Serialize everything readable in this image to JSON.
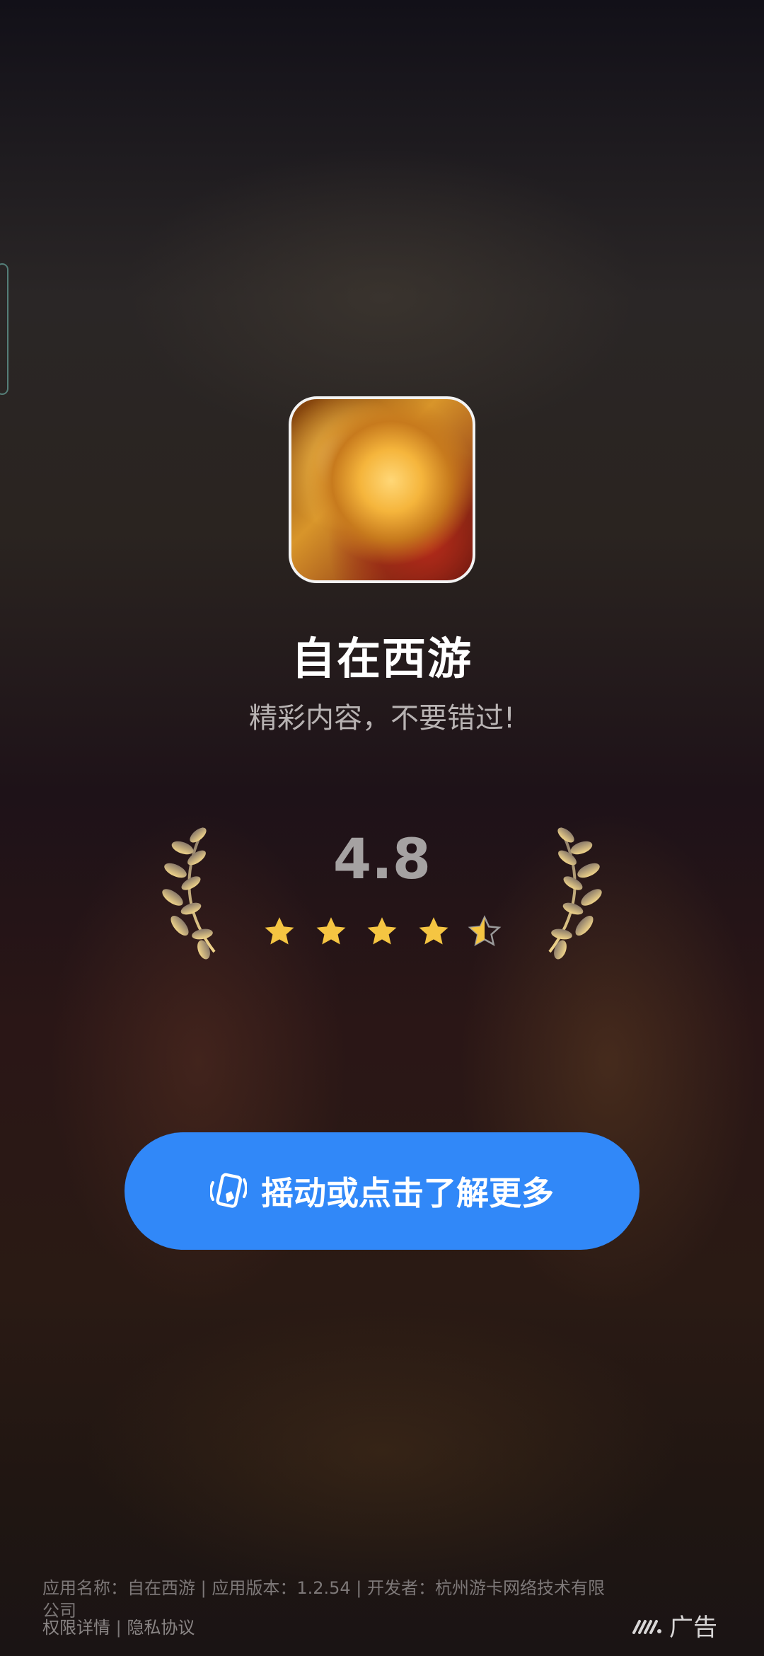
{
  "app": {
    "name": "自在西游",
    "tagline": "精彩内容，不要错过!",
    "rating": "4.8",
    "stars": 4.5
  },
  "cta": {
    "label": "摇动或点击了解更多",
    "icon": "shake-phone-icon"
  },
  "footer": {
    "info": "应用名称：自在西游 | 应用版本：1.2.54 | 开发者：杭州游卡网络技术有限公司",
    "permissions_label": "权限详情",
    "separator": "|",
    "privacy_label": "隐私协议"
  },
  "ad": {
    "label": "广告",
    "icon": "ad-network-logo-icon"
  },
  "colors": {
    "cta_background": "#3188f8",
    "star_gold": "#f5c542",
    "text_secondary": "#b8b3b3"
  }
}
